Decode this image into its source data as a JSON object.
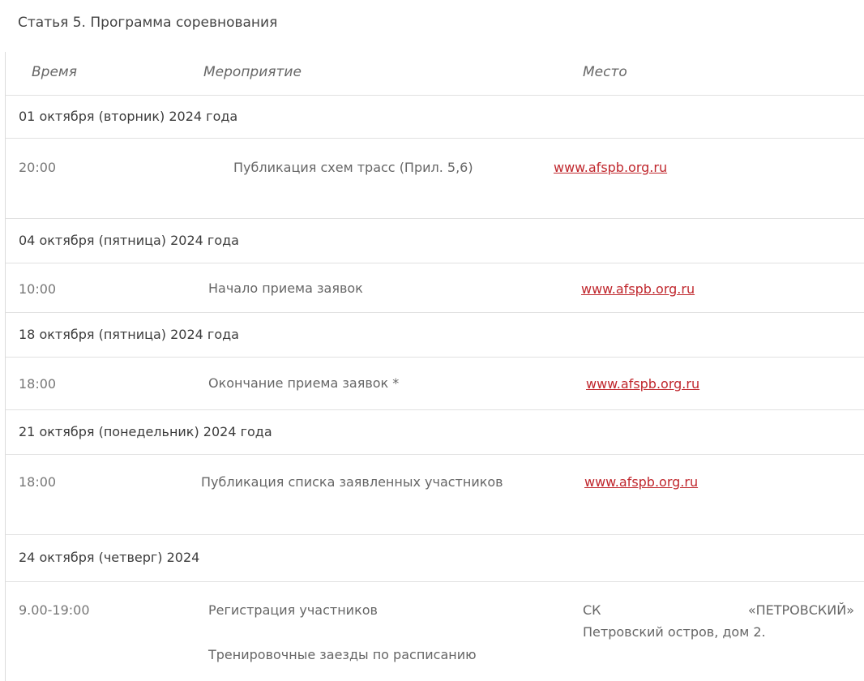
{
  "article_title": "Статья 5. Программа соревнования",
  "header": {
    "time": "Время",
    "event": "Мероприятие",
    "place": "Место"
  },
  "days": [
    {
      "date": "01 октября (вторник) 2024 года",
      "time": "20:00",
      "event": "Публикация схем трасс (Прил. 5,6)",
      "place": "www.afspb.org.ru"
    },
    {
      "date": "04 октября (пятница) 2024 года",
      "time": "10:00",
      "event": "Начало приема заявок",
      "place": "www.afspb.org.ru"
    },
    {
      "date": "18 октября (пятница) 2024 года",
      "time": "18:00",
      "event": "Окончание приема заявок *",
      "place": "www.afspb.org.ru"
    },
    {
      "date": "21 октября (понедельник) 2024 года",
      "time": "18:00",
      "event": "Публикация списка заявленных участников",
      "place": "www.afspb.org.ru"
    },
    {
      "date": "24 октября (четверг) 2024",
      "time": "9.00-19:00",
      "event": "Регистрация участников",
      "event_secondary": "Тренировочные заезды по расписанию",
      "place_line1": "СК «ПЕТРОВСКИЙ»",
      "place_line2": "Петровский остров, дом 2."
    }
  ]
}
